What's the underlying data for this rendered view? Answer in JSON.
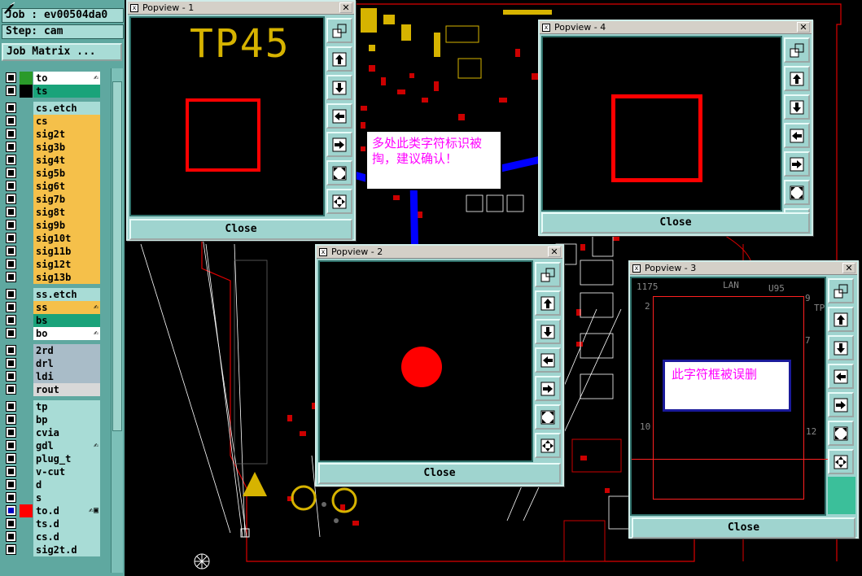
{
  "left": {
    "job": "Job : ev00504da0",
    "step": "Step: cam",
    "job_matrix_label": "Job Matrix ...",
    "layers": [
      {
        "name": "to",
        "color": "#ffffff",
        "swatch": "#2a9a2a",
        "mark": "✍"
      },
      {
        "name": "ts",
        "color": "#1aa37a",
        "swatch": "#000000",
        "mark": ""
      },
      {
        "name": "cs.etch",
        "color": "#a8dcd6",
        "swatch": "",
        "mark": "",
        "sep": true
      },
      {
        "name": "cs",
        "color": "#f5c04a",
        "swatch": "",
        "mark": ""
      },
      {
        "name": "sig2t",
        "color": "#f5c04a",
        "swatch": "",
        "mark": ""
      },
      {
        "name": "sig3b",
        "color": "#f5c04a",
        "swatch": "",
        "mark": ""
      },
      {
        "name": "sig4t",
        "color": "#f5c04a",
        "swatch": "",
        "mark": ""
      },
      {
        "name": "sig5b",
        "color": "#f5c04a",
        "swatch": "",
        "mark": ""
      },
      {
        "name": "sig6t",
        "color": "#f5c04a",
        "swatch": "",
        "mark": ""
      },
      {
        "name": "sig7b",
        "color": "#f5c04a",
        "swatch": "",
        "mark": ""
      },
      {
        "name": "sig8t",
        "color": "#f5c04a",
        "swatch": "",
        "mark": ""
      },
      {
        "name": "sig9b",
        "color": "#f5c04a",
        "swatch": "",
        "mark": ""
      },
      {
        "name": "sig10t",
        "color": "#f5c04a",
        "swatch": "",
        "mark": ""
      },
      {
        "name": "sig11b",
        "color": "#f5c04a",
        "swatch": "",
        "mark": ""
      },
      {
        "name": "sig12t",
        "color": "#f5c04a",
        "swatch": "",
        "mark": ""
      },
      {
        "name": "sig13b",
        "color": "#f5c04a",
        "swatch": "",
        "mark": ""
      },
      {
        "name": "ss.etch",
        "color": "#a8dcd6",
        "swatch": "",
        "mark": "",
        "sep": true
      },
      {
        "name": "ss",
        "color": "#f5c04a",
        "swatch": "",
        "mark": "✍"
      },
      {
        "name": "bs",
        "color": "#1aa37a",
        "swatch": "",
        "mark": ""
      },
      {
        "name": "bo",
        "color": "#ffffff",
        "swatch": "",
        "mark": "✍"
      },
      {
        "name": "2rd",
        "color": "#a9bcc8",
        "swatch": "",
        "mark": "",
        "sep": true
      },
      {
        "name": "drl",
        "color": "#a9bcc8",
        "swatch": "",
        "mark": ""
      },
      {
        "name": "ldi",
        "color": "#a9bcc8",
        "swatch": "",
        "mark": ""
      },
      {
        "name": "rout",
        "color": "#d8d8d8",
        "swatch": "",
        "mark": ""
      },
      {
        "name": "tp",
        "color": "#a8dcd6",
        "swatch": "",
        "mark": "",
        "sep": true
      },
      {
        "name": "bp",
        "color": "#a8dcd6",
        "swatch": "",
        "mark": ""
      },
      {
        "name": "cvia",
        "color": "#a8dcd6",
        "swatch": "",
        "mark": ""
      },
      {
        "name": "gdl",
        "color": "#a8dcd6",
        "swatch": "",
        "mark": "✍"
      },
      {
        "name": "plug_t",
        "color": "#a8dcd6",
        "swatch": "",
        "mark": ""
      },
      {
        "name": "v-cut",
        "color": "#a8dcd6",
        "swatch": "",
        "mark": ""
      },
      {
        "name": "d",
        "color": "#a8dcd6",
        "swatch": "",
        "mark": ""
      },
      {
        "name": "s",
        "color": "#a8dcd6",
        "swatch": "",
        "mark": ""
      },
      {
        "name": "to.d",
        "color": "#a8dcd6",
        "swatch": "#ff0000",
        "mark": "✍▣",
        "active": true
      },
      {
        "name": "ts.d",
        "color": "#a8dcd6",
        "swatch": "",
        "mark": ""
      },
      {
        "name": "cs.d",
        "color": "#a8dcd6",
        "swatch": "",
        "mark": ""
      },
      {
        "name": "sig2t.d",
        "color": "#a8dcd6",
        "swatch": "",
        "mark": ""
      }
    ]
  },
  "popviews": [
    {
      "title": "Popview - 1",
      "close": "Close",
      "label": "TP45"
    },
    {
      "title": "Popview - 4",
      "close": "Close"
    },
    {
      "title": "Popview - 2",
      "close": "Close"
    },
    {
      "title": "Popview - 3",
      "close": "Close",
      "pcb_labels": [
        "1175",
        "LAN",
        "U95",
        "9",
        "2",
        "7",
        "TP",
        "10",
        "12"
      ]
    }
  ],
  "annotations": {
    "main": "多处此类字符标识被掏，建议确认！",
    "secondary": "此字符框被误删"
  },
  "colors": {
    "panel": "#9fd4cf",
    "silk": "#d6b300",
    "pad": "#ff0000",
    "arrow": "#0000ff"
  }
}
